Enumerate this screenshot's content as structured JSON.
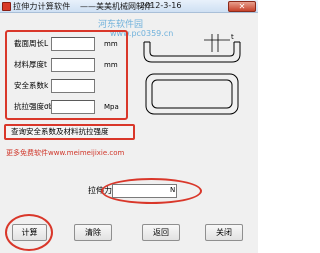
{
  "window": {
    "title": "拉伸力计算软件",
    "title_author": "——美美机械网制作",
    "title_date": "2012-3-16",
    "close_label": "✕"
  },
  "watermark": {
    "line1": "河东软件园",
    "line2": "www.pc0359.cn"
  },
  "params": [
    {
      "label": "截面周长L",
      "value": "",
      "unit": "mm"
    },
    {
      "label": "材料厚度t",
      "value": "",
      "unit": "mm"
    },
    {
      "label": "安全系数k",
      "value": "",
      "unit": ""
    },
    {
      "label": "抗拉强度σb",
      "value": "",
      "unit": "Mpa"
    }
  ],
  "drawing": {
    "dimension_label": "t"
  },
  "info_button": {
    "label": "查询安全系数及材料抗拉强度"
  },
  "website": {
    "text": "更多免费软件www.meimeijixie.com"
  },
  "force": {
    "label": "拉伸力",
    "value": "",
    "unit": "N"
  },
  "buttons": {
    "calculate": "计算",
    "clear": "清除",
    "back": "返回",
    "close": "关闭"
  },
  "colors": {
    "highlight": "#d9372a",
    "watermark": "#5aa7d8"
  }
}
